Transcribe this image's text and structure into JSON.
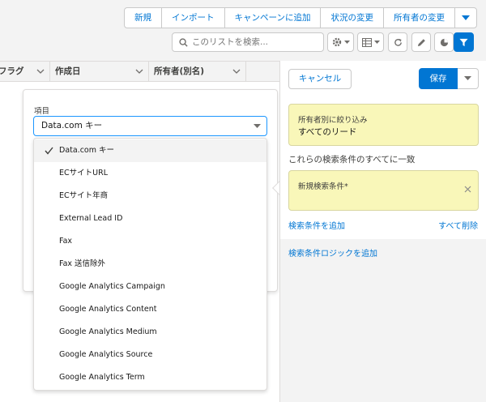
{
  "toolbar": {
    "buttons": [
      "新規",
      "インポート",
      "キャンペーンに追加",
      "状況の変更",
      "所有者の変更"
    ]
  },
  "search": {
    "placeholder": "このリストを検索..."
  },
  "table": {
    "columns": [
      "...フラグ",
      "作成日",
      "所有者(別名)"
    ]
  },
  "field_picker": {
    "label": "項目",
    "selected": "Data.com キー",
    "options": [
      "Data.com キー",
      "ECサイトURL",
      "ECサイト年商",
      "External Lead ID",
      "Fax",
      "Fax 送信除外",
      "Google Analytics Campaign",
      "Google Analytics Content",
      "Google Analytics Medium",
      "Google Analytics Source",
      "Google Analytics Term"
    ]
  },
  "filter_panel": {
    "cancel_label": "キャンセル",
    "save_label": "保存",
    "owner_filter_label": "所有者別に絞り込み",
    "owner_filter_value": "すべてのリード",
    "match_text": "これらの検索条件のすべてに一致",
    "new_filter_label": "新規検索条件*",
    "add_filter_link": "検索条件を追加",
    "remove_all_link": "すべて削除",
    "add_logic_link": "検索条件ロジックを追加"
  },
  "colors": {
    "accent": "#0176d3",
    "filter_card": "#f9f7b9",
    "focus_border": "#1b96ff"
  },
  "icons": [
    "chevron-down-icon",
    "search-icon",
    "gear-icon",
    "table-icon",
    "refresh-icon",
    "pencil-icon",
    "pie-chart-icon",
    "filter-icon",
    "check-icon",
    "close-icon"
  ]
}
